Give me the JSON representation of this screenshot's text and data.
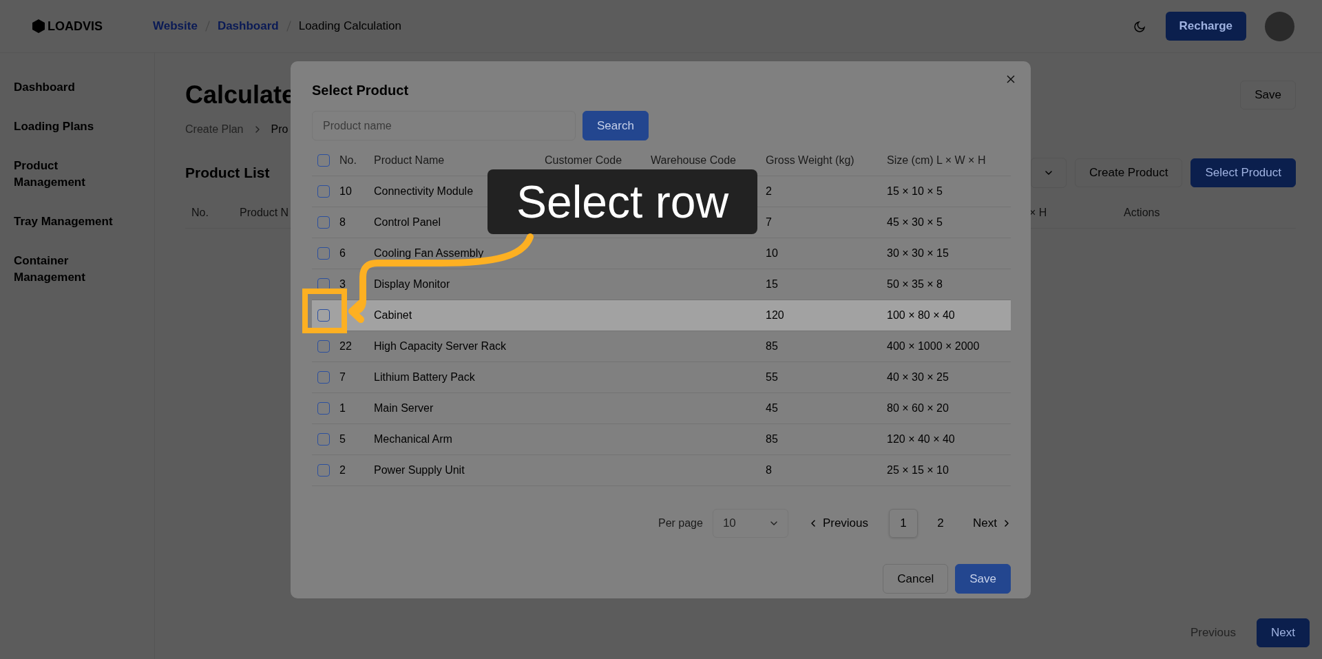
{
  "topbar": {
    "logo": "LOADVIS",
    "breadcrumb": [
      {
        "label": "Website",
        "kind": "link"
      },
      {
        "label": "Dashboard",
        "kind": "link"
      },
      {
        "label": "Loading Calculation",
        "kind": "current"
      }
    ],
    "recharge": "Recharge"
  },
  "sidebar": {
    "items": [
      "Dashboard",
      "Loading Plans",
      "Product Management",
      "Tray Management",
      "Container Management"
    ]
  },
  "page": {
    "title": "Calculate",
    "breadcrumb": [
      "Create Plan",
      "Pro"
    ],
    "save": "Save",
    "section_title": "Product List",
    "buttons": [
      {
        "label": "Create Product",
        "kind": "outline"
      },
      {
        "label": "Select Product",
        "kind": "primary"
      }
    ],
    "columns": [
      "No.",
      "Product N",
      "× H",
      "Actions"
    ],
    "pager": [
      {
        "label": "Previous",
        "kind": "text"
      },
      {
        "label": "Next",
        "kind": "primary"
      }
    ]
  },
  "modal": {
    "title": "Select Product",
    "search": {
      "placeholder": "Product name",
      "button": "Search"
    },
    "all_checked": false,
    "columns": [
      "No.",
      "Product Name",
      "Customer Code",
      "Warehouse Code",
      "Gross Weight (kg)",
      "Size (cm) L × W × H"
    ],
    "rows": [
      {
        "no": "10",
        "name": "Connectivity Module",
        "weight": "2",
        "size": "15 × 10 × 5",
        "checked": false,
        "highlighted": false
      },
      {
        "no": "8",
        "name": "Control Panel",
        "weight": "7",
        "size": "45 × 30 × 5",
        "checked": false,
        "highlighted": false
      },
      {
        "no": "6",
        "name": "Cooling Fan Assembly",
        "weight": "10",
        "size": "30 × 30 × 15",
        "checked": false,
        "highlighted": false
      },
      {
        "no": "3",
        "name": "Display Monitor",
        "weight": "15",
        "size": "50 × 35 × 8",
        "checked": false,
        "highlighted": false
      },
      {
        "name": "Cabinet",
        "weight": "120",
        "size": "100 × 80 × 40",
        "checked": false,
        "highlighted": true
      },
      {
        "no": "22",
        "name": "High Capacity Server Rack",
        "weight": "85",
        "size": "400 × 1000 × 2000",
        "checked": false,
        "highlighted": false
      },
      {
        "no": "7",
        "name": "Lithium Battery Pack",
        "weight": "55",
        "size": "40 × 30 × 25",
        "checked": false,
        "highlighted": false
      },
      {
        "no": "1",
        "name": "Main Server",
        "weight": "45",
        "size": "80 × 60 × 20",
        "checked": false,
        "highlighted": false
      },
      {
        "no": "5",
        "name": "Mechanical Arm",
        "weight": "85",
        "size": "120 × 40 × 40",
        "checked": false,
        "highlighted": false
      },
      {
        "no": "2",
        "name": "Power Supply Unit",
        "weight": "8",
        "size": "25 × 15 × 10",
        "checked": false,
        "highlighted": false
      }
    ],
    "pagination": {
      "per_page_label": "Per page",
      "per_page": "10",
      "previous": "Previous",
      "pages": [
        {
          "label": "1",
          "selected": true
        },
        {
          "label": "2",
          "selected": false
        }
      ],
      "next": "Next"
    },
    "buttons": [
      {
        "label": "Cancel",
        "kind": "outline"
      },
      {
        "label": "Save",
        "kind": "primary"
      }
    ]
  },
  "tutorial": {
    "callout": "Select row"
  }
}
